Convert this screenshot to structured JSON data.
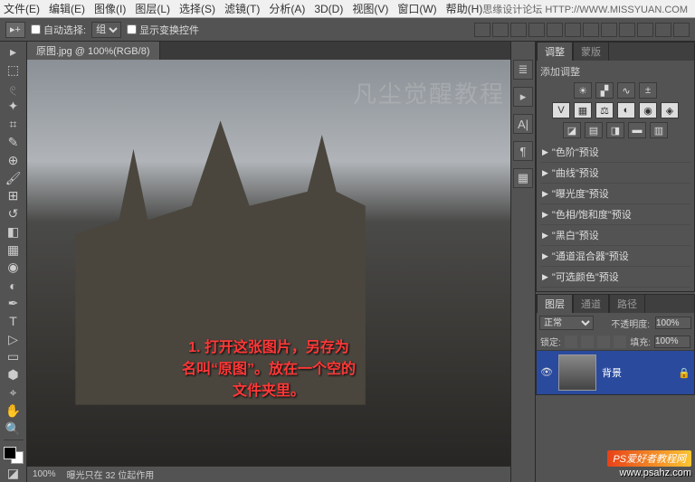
{
  "menubar": [
    "文件(E)",
    "编辑(E)",
    "图像(I)",
    "图层(L)",
    "选择(S)",
    "滤镜(T)",
    "分析(A)",
    "3D(D)",
    "视图(V)",
    "窗口(W)",
    "帮助(H)"
  ],
  "topwatermark": "思缘设计论坛   HTTP://WWW.MISSYUAN.COM",
  "options": {
    "auto_select": "自动选择:",
    "dropdown": "组",
    "show_transform": "显示变换控件"
  },
  "document": {
    "tab": "原图.jpg @ 100%(RGB/8)",
    "zoom": "100%",
    "status": "曝光只在 32 位起作用"
  },
  "overlay": {
    "line1": "1. 打开这张图片，另存为",
    "line2": "名叫“原图”。放在一个空的",
    "line3": "文件夹里。",
    "ghost": "凡尘觉醒教程"
  },
  "adjustments": {
    "tab1": "调整",
    "tab2": "蒙版",
    "label": "添加调整",
    "presets": [
      "\"色阶\"预设",
      "\"曲线\"预设",
      "\"曝光度\"预设",
      "\"色相/饱和度\"预设",
      "\"黑白\"预设",
      "\"通道混合器\"预设",
      "\"可选颜色\"预设"
    ]
  },
  "layers": {
    "tab1": "图层",
    "tab2": "通道",
    "tab3": "路径",
    "blend": "正常",
    "opacity_label": "不透明度:",
    "opacity": "100%",
    "lock_label": "锁定:",
    "fill_label": "填充:",
    "fill": "100%",
    "layer_name": "背景"
  },
  "brand": {
    "name": "PS爱好者教程网",
    "url": "www.psahz.com"
  }
}
